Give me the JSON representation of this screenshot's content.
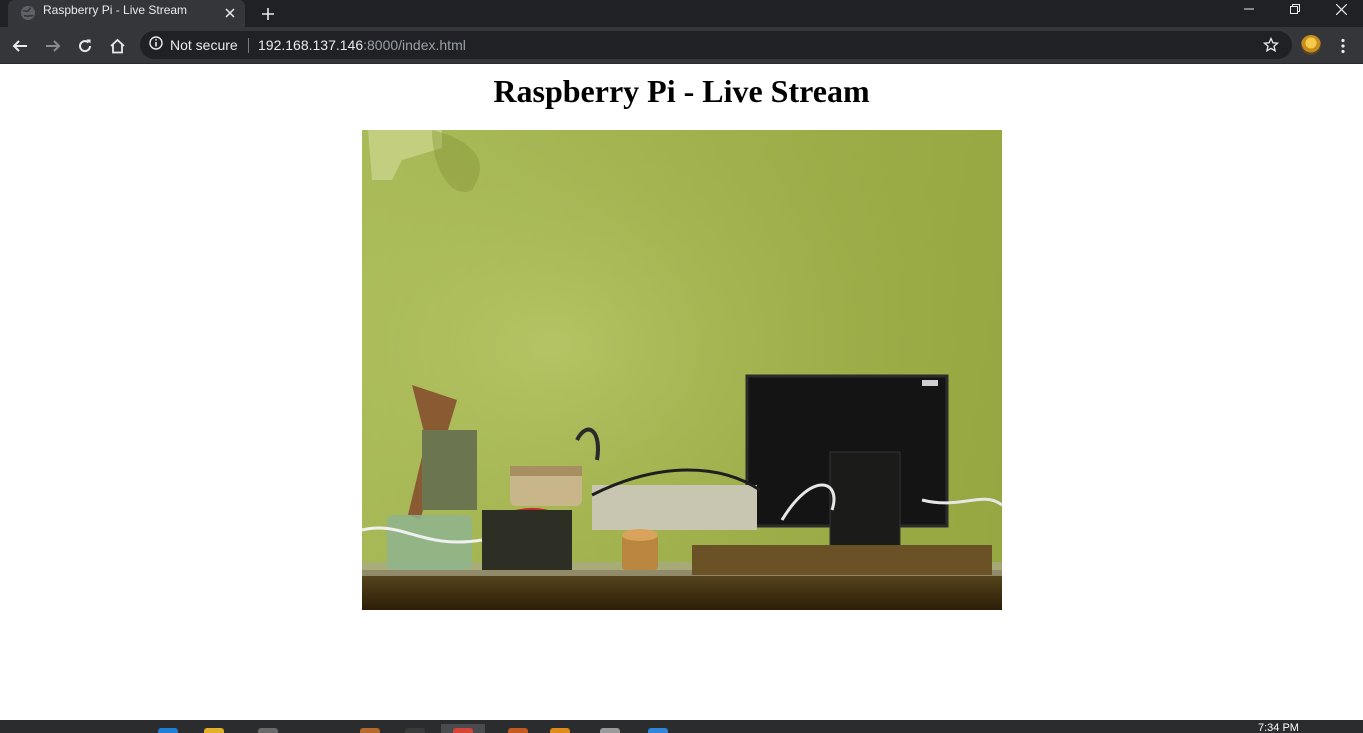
{
  "browser": {
    "tab": {
      "title": "Raspberry Pi - Live Stream",
      "favicon": "globe-icon"
    },
    "toolbar": {
      "security_label": "Not secure",
      "url_host": "192.168.137.146",
      "url_rest": ":8000/index.html"
    }
  },
  "page": {
    "heading": "Raspberry Pi - Live Stream",
    "stream": {
      "content": "live camera frame of a workbench with a black monitor, cables, jars and electronics against a green wall"
    }
  },
  "taskbar": {
    "clock": "7:34 PM"
  },
  "colors": {
    "tabstrip_bg": "#202124",
    "toolbar_bg": "#35363a",
    "omnibox_bg": "#202124",
    "text_light": "#e8eaed",
    "text_dim": "#9aa0a6",
    "page_bg": "#ffffff",
    "taskbar_bg": "#2b2c2e"
  }
}
